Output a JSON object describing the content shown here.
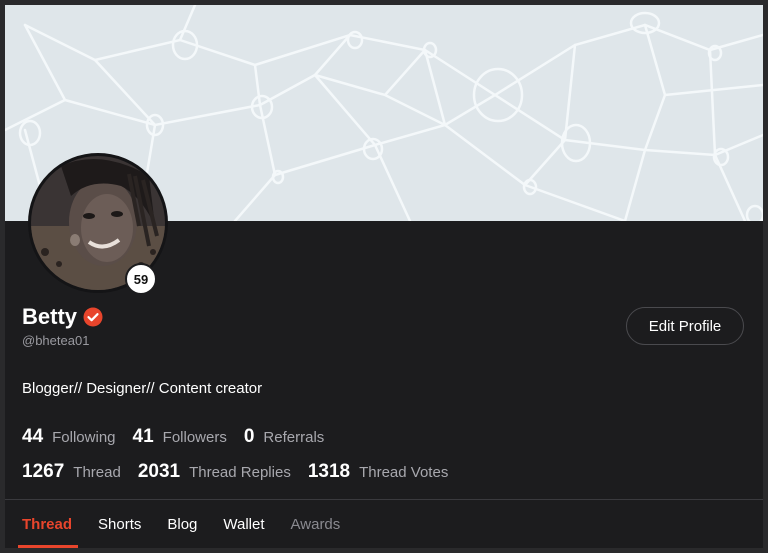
{
  "profile": {
    "display_name": "Betty",
    "handle": "@bhetea01",
    "level": "59",
    "bio": "Blogger// Designer// Content creator",
    "verified_icon": "verified-check-icon",
    "edit_label": "Edit Profile"
  },
  "stats_row1": [
    {
      "value": "44",
      "label": "Following"
    },
    {
      "value": "41",
      "label": "Followers"
    },
    {
      "value": "0",
      "label": "Referrals"
    }
  ],
  "stats_row2": [
    {
      "value": "1267",
      "label": "Thread"
    },
    {
      "value": "2031",
      "label": "Thread Replies"
    },
    {
      "value": "1318",
      "label": "Thread Votes"
    }
  ],
  "tabs": [
    {
      "label": "Thread",
      "state": "active"
    },
    {
      "label": "Shorts",
      "state": "normal"
    },
    {
      "label": "Blog",
      "state": "normal"
    },
    {
      "label": "Wallet",
      "state": "normal"
    },
    {
      "label": "Awards",
      "state": "muted"
    }
  ],
  "colors": {
    "accent": "#e8452c",
    "background": "#1c1c1e",
    "cover": "#dfe6ea"
  }
}
